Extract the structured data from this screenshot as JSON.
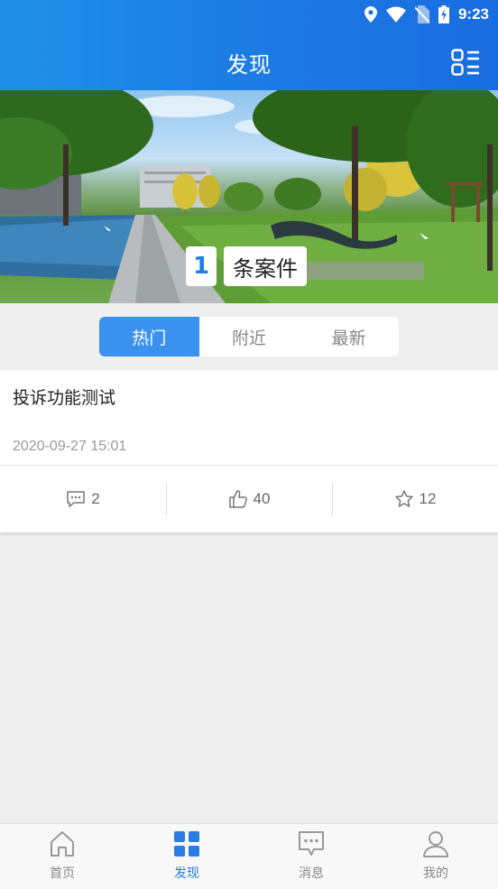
{
  "status_bar": {
    "time": "9:23"
  },
  "header": {
    "title": "发现"
  },
  "banner": {
    "count": "1",
    "count_label": "条案件"
  },
  "tabs": [
    {
      "label": "热门",
      "active": true
    },
    {
      "label": "附近",
      "active": false
    },
    {
      "label": "最新",
      "active": false
    }
  ],
  "cases": [
    {
      "title": "投诉功能测试",
      "date": "2020-09-27 15:01",
      "comments": "2",
      "likes": "40",
      "favorites": "12"
    }
  ],
  "bottom_nav": [
    {
      "label": "首页",
      "icon": "home-icon",
      "active": false
    },
    {
      "label": "发现",
      "icon": "grid-icon",
      "active": true
    },
    {
      "label": "消息",
      "icon": "message-icon",
      "active": false
    },
    {
      "label": "我的",
      "icon": "user-icon",
      "active": false
    }
  ],
  "colors": {
    "primary": "#1f7ee6",
    "tab_active": "#3b91f0",
    "background": "#efefef"
  }
}
